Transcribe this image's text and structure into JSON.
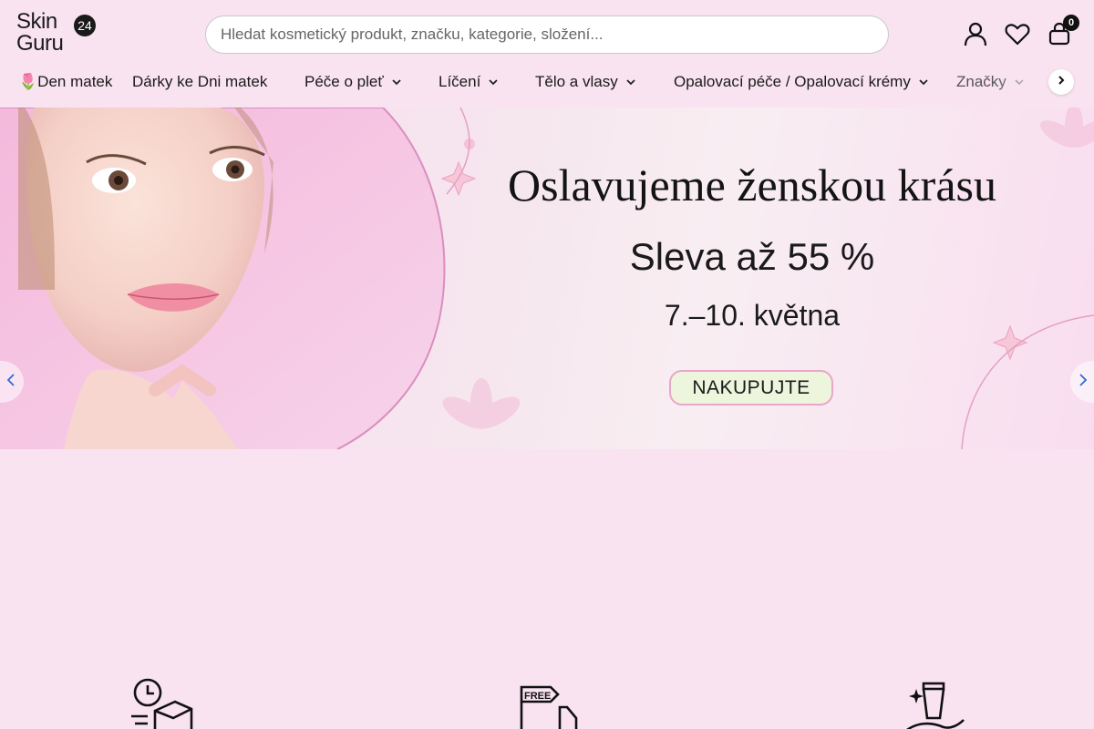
{
  "logo": {
    "line1": "Skin",
    "line2": "Guru",
    "badge": "24"
  },
  "search": {
    "placeholder": "Hledat kosmetický produkt, značku, kategorie, složení..."
  },
  "header_icons": [
    "user-icon",
    "heart-icon",
    "bag-icon"
  ],
  "cart": {
    "count": "0"
  },
  "nav": {
    "items": [
      {
        "label": "🌷Den matek",
        "dropdown": false
      },
      {
        "label": "Dárky ke Dni matek",
        "dropdown": false
      },
      {
        "label": "Péče o pleť",
        "dropdown": true
      },
      {
        "label": "Líčení",
        "dropdown": true
      },
      {
        "label": "Tělo a vlasy",
        "dropdown": true
      },
      {
        "label": "Opalovací péče / Opalovací krémy",
        "dropdown": true
      },
      {
        "label": "Značky",
        "dropdown": true
      }
    ]
  },
  "hero": {
    "title": "Oslavujeme ženskou krásu",
    "subtitle": "Sleva až 55 %",
    "dates": "7.–10. května",
    "cta": "NAKUPUJTE"
  },
  "features": [
    {
      "icon": "fast-delivery-box-icon"
    },
    {
      "icon": "free-shipping-truck-icon"
    },
    {
      "icon": "cosmetic-tube-hand-icon"
    }
  ],
  "colors": {
    "background": "#f9e3f1",
    "cta_fill": "#eef5dd",
    "cta_border": "#e9a6c9",
    "carousel_arrow": "#2b6cd6"
  }
}
